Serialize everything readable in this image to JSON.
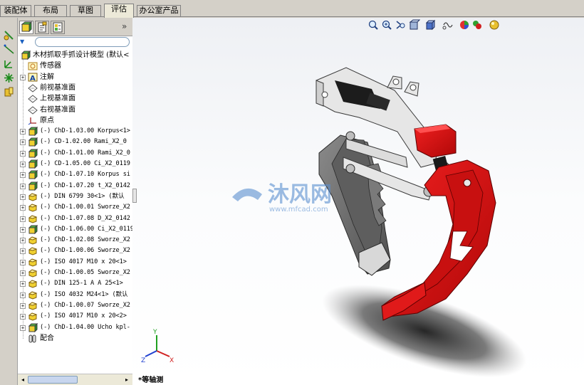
{
  "tabs": [
    {
      "label": "装配体",
      "active": false
    },
    {
      "label": "布局",
      "active": false
    },
    {
      "label": "草图",
      "active": false
    },
    {
      "label": "评估",
      "active": true
    },
    {
      "label": "办公室产品",
      "active": false
    }
  ],
  "feature_manager": {
    "expand_glyph": "»",
    "filter_glyph": "▼",
    "tree": [
      {
        "label": "木材抓取手抓设计模型  (默认<",
        "icon": "assembly-icon",
        "expander": "",
        "mono": false
      },
      {
        "label": "传感器",
        "icon": "sensor-icon",
        "expander": "",
        "mono": false
      },
      {
        "label": "注解",
        "icon": "annotation-icon",
        "expander": "+",
        "mono": false
      },
      {
        "label": "前视基准面",
        "icon": "plane-icon",
        "expander": "",
        "mono": false
      },
      {
        "label": "上视基准面",
        "icon": "plane-icon",
        "expander": "",
        "mono": false
      },
      {
        "label": "右视基准面",
        "icon": "plane-icon",
        "expander": "",
        "mono": false
      },
      {
        "label": "原点",
        "icon": "origin-icon",
        "expander": "",
        "mono": false
      },
      {
        "label": "(-) ChD-1.03.00 Korpus<1>",
        "icon": "subassembly-icon",
        "expander": "+",
        "mono": true
      },
      {
        "label": "(-) CD-1.02.00 Rami_X2_0",
        "icon": "subassembly-icon",
        "expander": "+",
        "mono": true
      },
      {
        "label": "(-) ChD-1.01.00 Rami_X2_0",
        "icon": "subassembly-icon",
        "expander": "+",
        "mono": true
      },
      {
        "label": "(-) CD-1.05.00 Ci_X2_0119",
        "icon": "subassembly-icon",
        "expander": "+",
        "mono": true
      },
      {
        "label": "(-) ChD-1.07.10 Korpus si",
        "icon": "subassembly-icon",
        "expander": "+",
        "mono": true
      },
      {
        "label": "(-) ChD-1.07.20 t_X2_0142",
        "icon": "subassembly-icon",
        "expander": "+",
        "mono": true
      },
      {
        "label": "(-) DIN 6799 30<1> (默认",
        "icon": "part-icon",
        "expander": "+",
        "mono": true
      },
      {
        "label": "(-) ChD-1.00.01 Sworze_X2",
        "icon": "part-icon",
        "expander": "+",
        "mono": true
      },
      {
        "label": "(-) ChD-1.07.08 D_X2_0142",
        "icon": "part-icon",
        "expander": "+",
        "mono": true
      },
      {
        "label": "(-) ChD-1.06.00 Ci_X2_0119",
        "icon": "subassembly-icon",
        "expander": "+",
        "mono": true
      },
      {
        "label": "(-) ChD-1.02.08 Sworze_X2",
        "icon": "part-icon",
        "expander": "+",
        "mono": true
      },
      {
        "label": "(-) ChD-1.00.06 Sworze_X2",
        "icon": "part-icon",
        "expander": "+",
        "mono": true
      },
      {
        "label": "(-) ISO 4017 M10 x 20<1>",
        "icon": "part-icon",
        "expander": "+",
        "mono": true
      },
      {
        "label": "(-) ChD-1.00.05 Sworze_X2",
        "icon": "part-icon",
        "expander": "+",
        "mono": true
      },
      {
        "label": "(-) DIN 125-1 A A 25<1>",
        "icon": "part-icon",
        "expander": "+",
        "mono": true
      },
      {
        "label": "(-) ISO 4032 M24<1> (默认",
        "icon": "part-icon",
        "expander": "+",
        "mono": true
      },
      {
        "label": "(-) ChD-1.00.07 Sworze_X2",
        "icon": "part-icon",
        "expander": "+",
        "mono": true
      },
      {
        "label": "(-) ISO 4017 M10 x 20<2>",
        "icon": "part-icon",
        "expander": "+",
        "mono": true
      },
      {
        "label": "(-) ChD-1.04.00 Ucho kpl-",
        "icon": "subassembly-icon",
        "expander": "+",
        "mono": true
      },
      {
        "label": "配合",
        "icon": "mates-icon",
        "expander": "",
        "mono": false
      }
    ]
  },
  "viewport": {
    "view_label": "*等轴测",
    "watermark_text": "沐风网",
    "watermark_url": "www.mfcad.com",
    "triad": {
      "x": "X",
      "y": "Y",
      "z": "Z"
    }
  },
  "colors": {
    "red_part": "#e01a1a",
    "gray_part": "#6e6e6e",
    "frame_part": "#e8e8e8",
    "watermark": "#5a8fd0"
  }
}
